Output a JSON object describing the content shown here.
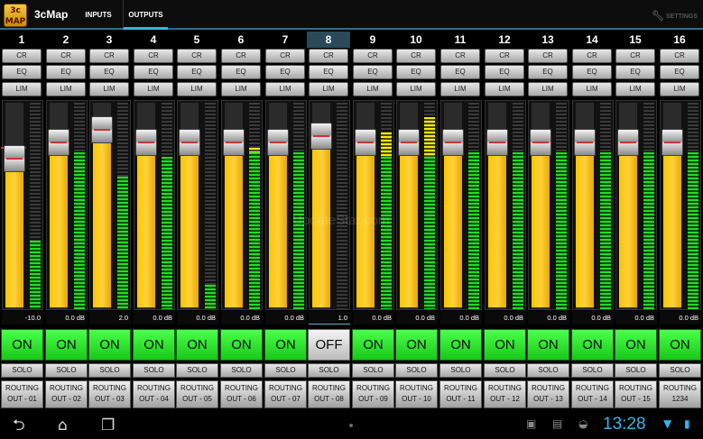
{
  "app": {
    "logo_text": "3c MAP",
    "name": "3cMap",
    "tabs": [
      {
        "label": "INPUTS",
        "active": false
      },
      {
        "label": "OUTPUTS",
        "active": true
      }
    ],
    "settings_label": "SETTINGS",
    "accent_color": "#33b5e5"
  },
  "channel_buttons": {
    "cr": "CR",
    "eq": "EQ",
    "lim": "LIM",
    "solo": "SOLO"
  },
  "channels": [
    {
      "num": "1",
      "value": "-10.0",
      "state": "ON",
      "routing": [
        "ROUTING",
        "OUT - 01"
      ],
      "fader_level": 0.72,
      "meter_level": 0.33,
      "meter_hot": 0.0
    },
    {
      "num": "2",
      "value": "0.0 dB",
      "state": "ON",
      "routing": [
        "ROUTING",
        "OUT - 02"
      ],
      "fader_level": 0.8,
      "meter_level": 0.76,
      "meter_hot": 0.0
    },
    {
      "num": "3",
      "value": "2.0",
      "state": "ON",
      "routing": [
        "ROUTING",
        "OUT - 03"
      ],
      "fader_level": 0.86,
      "meter_level": 0.64,
      "meter_hot": 0.0
    },
    {
      "num": "4",
      "value": "0.0 dB",
      "state": "ON",
      "routing": [
        "ROUTING",
        "OUT - 04"
      ],
      "fader_level": 0.8,
      "meter_level": 0.74,
      "meter_hot": 0.0
    },
    {
      "num": "5",
      "value": "0.0 dB",
      "state": "ON",
      "routing": [
        "ROUTING",
        "OUT - 05"
      ],
      "fader_level": 0.8,
      "meter_level": 0.12,
      "meter_hot": 0.0
    },
    {
      "num": "6",
      "value": "0.0 dB",
      "state": "ON",
      "routing": [
        "ROUTING",
        "OUT - 06"
      ],
      "fader_level": 0.8,
      "meter_level": 0.76,
      "meter_hot": 0.02
    },
    {
      "num": "7",
      "value": "0.0 dB",
      "state": "ON",
      "routing": [
        "ROUTING",
        "OUT - 07"
      ],
      "fader_level": 0.8,
      "meter_level": 0.76,
      "meter_hot": 0.0
    },
    {
      "num": "8",
      "value": "1.0",
      "state": "OFF",
      "routing": [
        "ROUTING",
        "OUT - 08"
      ],
      "fader_level": 0.83,
      "meter_level": 0.0,
      "meter_hot": 0.0
    },
    {
      "num": "9",
      "value": "0.0 dB",
      "state": "ON",
      "routing": [
        "ROUTING",
        "OUT - 09"
      ],
      "fader_level": 0.8,
      "meter_level": 0.74,
      "meter_hot": 0.12
    },
    {
      "num": "10",
      "value": "0.0 dB",
      "state": "ON",
      "routing": [
        "ROUTING",
        "OUT - 10"
      ],
      "fader_level": 0.8,
      "meter_level": 0.74,
      "meter_hot": 0.19
    },
    {
      "num": "11",
      "value": "0.0 dB",
      "state": "ON",
      "routing": [
        "ROUTING",
        "OUT - 11"
      ],
      "fader_level": 0.8,
      "meter_level": 0.76,
      "meter_hot": 0.0
    },
    {
      "num": "12",
      "value": "0.0 dB",
      "state": "ON",
      "routing": [
        "ROUTING",
        "OUT - 12"
      ],
      "fader_level": 0.8,
      "meter_level": 0.76,
      "meter_hot": 0.0
    },
    {
      "num": "13",
      "value": "0.0 dB",
      "state": "ON",
      "routing": [
        "ROUTING",
        "OUT - 13"
      ],
      "fader_level": 0.8,
      "meter_level": 0.76,
      "meter_hot": 0.0
    },
    {
      "num": "14",
      "value": "0.0 dB",
      "state": "ON",
      "routing": [
        "ROUTING",
        "OUT - 14"
      ],
      "fader_level": 0.8,
      "meter_level": 0.76,
      "meter_hot": 0.0
    },
    {
      "num": "15",
      "value": "0.0 dB",
      "state": "ON",
      "routing": [
        "ROUTING",
        "OUT - 15"
      ],
      "fader_level": 0.8,
      "meter_level": 0.76,
      "meter_hot": 0.0
    },
    {
      "num": "16",
      "value": "0.0 dB",
      "state": "ON",
      "routing": [
        "ROUTING",
        "1234"
      ],
      "fader_level": 0.8,
      "meter_level": 0.76,
      "meter_hot": 0.0
    }
  ],
  "selected_channel": "8",
  "watermark": "UpdateStar.com",
  "status_bar": {
    "clock": "13:28",
    "icons": [
      "back-icon",
      "home-icon",
      "recent-apps-icon",
      "gallery-icon",
      "bag-icon",
      "android-icon",
      "wifi-icon",
      "battery-icon"
    ]
  }
}
